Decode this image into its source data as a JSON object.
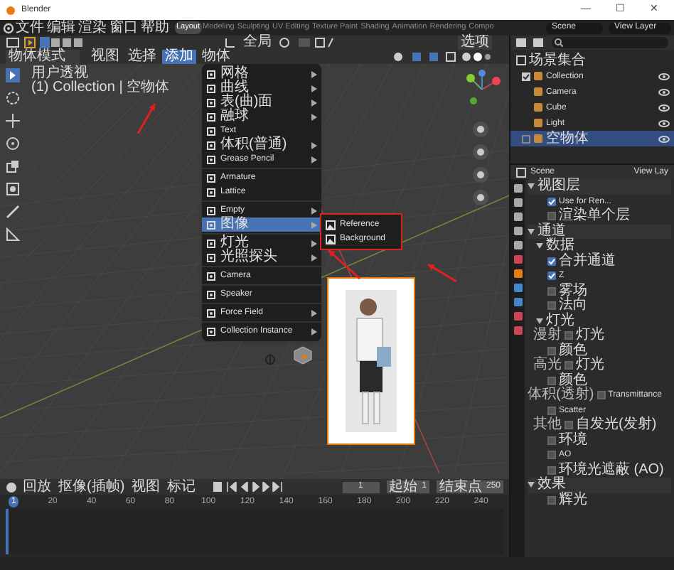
{
  "title_bar": {
    "title": "Blender",
    "controls": [
      "—",
      "☐",
      "✕"
    ]
  },
  "menubar": {
    "menus": [
      "文件",
      "编辑",
      "渲染",
      "窗口",
      "帮助"
    ],
    "workspaces": [
      {
        "label": "Layout",
        "selected": true
      },
      {
        "label": "Modeling",
        "selected": false
      },
      {
        "label": "Sculpting",
        "selected": false
      },
      {
        "label": "UV Editing",
        "selected": false
      },
      {
        "label": "Texture Paint",
        "selected": false
      },
      {
        "label": "Shading",
        "selected": false
      },
      {
        "label": "Animation",
        "selected": false
      },
      {
        "label": "Rendering",
        "selected": false
      },
      {
        "label": "Compo",
        "selected": false
      }
    ],
    "scene": "Scene",
    "view_layer": "View Layer"
  },
  "viewport_header": {
    "orientation": "全局",
    "options": "选项",
    "mode": "物体模式",
    "menus": [
      {
        "label": "视图",
        "selected": false
      },
      {
        "label": "选择",
        "selected": false
      },
      {
        "label": "添加",
        "selected": true
      },
      {
        "label": "物体",
        "selected": false
      }
    ]
  },
  "viewport": {
    "overlay": [
      "用户透视",
      "(1) Collection | 空物体"
    ]
  },
  "add_menu": {
    "items": [
      {
        "kind": "item",
        "label": "网格",
        "submenu": true,
        "selected": false
      },
      {
        "kind": "item",
        "label": "曲线",
        "submenu": true,
        "selected": false
      },
      {
        "kind": "item",
        "label": "表(曲)面",
        "submenu": true,
        "selected": false
      },
      {
        "kind": "item",
        "label": "融球",
        "submenu": true,
        "selected": false
      },
      {
        "kind": "item",
        "label": "Text",
        "submenu": false,
        "selected": false
      },
      {
        "kind": "item",
        "label": "体积(普通)",
        "submenu": true,
        "selected": false
      },
      {
        "kind": "item",
        "label": "Grease Pencil",
        "submenu": true,
        "selected": false
      },
      {
        "kind": "separator"
      },
      {
        "kind": "item",
        "label": "Armature",
        "submenu": false,
        "selected": false
      },
      {
        "kind": "item",
        "label": "Lattice",
        "submenu": false,
        "selected": false
      },
      {
        "kind": "separator"
      },
      {
        "kind": "item",
        "label": "Empty",
        "submenu": true,
        "selected": false
      },
      {
        "kind": "item",
        "label": "图像",
        "submenu": true,
        "selected": true
      },
      {
        "kind": "separator"
      },
      {
        "kind": "item",
        "label": "灯光",
        "submenu": true,
        "selected": false
      },
      {
        "kind": "item",
        "label": "光照探头",
        "submenu": true,
        "selected": false
      },
      {
        "kind": "separator"
      },
      {
        "kind": "item",
        "label": "Camera",
        "submenu": false,
        "selected": false
      },
      {
        "kind": "separator"
      },
      {
        "kind": "item",
        "label": "Speaker",
        "submenu": false,
        "selected": false
      },
      {
        "kind": "separator"
      },
      {
        "kind": "item",
        "label": "Force Field",
        "submenu": true,
        "selected": false
      },
      {
        "kind": "separator"
      },
      {
        "kind": "item",
        "label": "Collection Instance",
        "submenu": true,
        "selected": false
      }
    ]
  },
  "image_submenu": [
    "Reference",
    "Background"
  ],
  "outliner": {
    "root": "场景集合",
    "items": [
      {
        "label": "Collection",
        "checked": true,
        "selected": false,
        "children": [
          {
            "label": "Camera",
            "selected": false
          },
          {
            "label": "Cube",
            "selected": false
          },
          {
            "label": "Light",
            "selected": false
          }
        ]
      },
      {
        "label": "空物体",
        "checked": false,
        "selected": true
      }
    ]
  },
  "properties": {
    "scene": "Scene",
    "view_layer": "View Lay",
    "rows": [
      {
        "kind": "section",
        "label": "视图层"
      },
      {
        "kind": "check",
        "label": "Use for Ren...",
        "checked": true
      },
      {
        "kind": "check",
        "label": "渲染单个层",
        "checked": false
      },
      {
        "kind": "section",
        "label": "通道"
      },
      {
        "kind": "subsection",
        "label": "数据"
      },
      {
        "kind": "check",
        "label": "合并通道",
        "checked": true
      },
      {
        "kind": "check",
        "label": "Z",
        "checked": true
      },
      {
        "kind": "check",
        "label": "雾场",
        "checked": false
      },
      {
        "kind": "check",
        "label": "法向",
        "checked": false
      },
      {
        "kind": "subsection",
        "label": "灯光"
      },
      {
        "kind": "check",
        "side": "漫射",
        "label": "灯光",
        "checked": false
      },
      {
        "kind": "check",
        "label": "颜色",
        "checked": false
      },
      {
        "kind": "check",
        "side": "高光",
        "label": "灯光",
        "checked": false
      },
      {
        "kind": "check",
        "label": "颜色",
        "checked": false
      },
      {
        "kind": "check",
        "side": "体积(透射)",
        "label": "Transmittance",
        "checked": false
      },
      {
        "kind": "check",
        "label": "Scatter",
        "checked": false
      },
      {
        "kind": "check",
        "side": "其他",
        "label": "自发光(发射)",
        "checked": false
      },
      {
        "kind": "check",
        "label": "环境",
        "checked": false
      },
      {
        "kind": "check",
        "label": "AO",
        "checked": false
      },
      {
        "kind": "check",
        "label": "环境光遮蔽 (AO)",
        "checked": false
      },
      {
        "kind": "section",
        "label": "效果"
      },
      {
        "kind": "check",
        "label": "辉光",
        "checked": false
      }
    ]
  },
  "timeline": {
    "menus": [
      "回放",
      "抠像(插帧)",
      "视图",
      "标记"
    ],
    "current_frame": "1",
    "start_label": "起始",
    "start": "1",
    "end_label": "结束点",
    "end": "250",
    "ruler_current": "1",
    "ticks": [
      "20",
      "40",
      "60",
      "80",
      "100",
      "120",
      "140",
      "160",
      "180",
      "200",
      "220",
      "240"
    ]
  }
}
